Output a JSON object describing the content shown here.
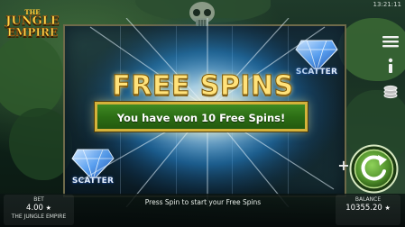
{
  "game": {
    "logo": {
      "line_small": "THE",
      "line1": "JUNGLE",
      "line2": "EMPIRE"
    },
    "clock": "13:21:11"
  },
  "reels": {
    "scatter_label": "SCATTER"
  },
  "feature": {
    "title": "FREE SPINS",
    "message": "You have won 10 Free Spins!"
  },
  "controls": {
    "menu_icon": "hamburger-menu-icon",
    "info_icon": "info-icon",
    "coins_icon": "coin-stack-icon",
    "plus_label": "+",
    "spin_icon": "spin-arrow-icon"
  },
  "bottom_bar": {
    "bet_label": "BET",
    "bet_value": "4.00",
    "game_name": "THE JUNGLE EMPIRE",
    "status": "Press Spin to start your Free Spins",
    "balance_label": "BALANCE",
    "balance_value": "10355.20"
  },
  "colors": {
    "banner_green": "#2c6e15",
    "banner_border": "#d4b23a",
    "title_gold": "#ffe27a",
    "spin_green": "#5fa33a"
  }
}
